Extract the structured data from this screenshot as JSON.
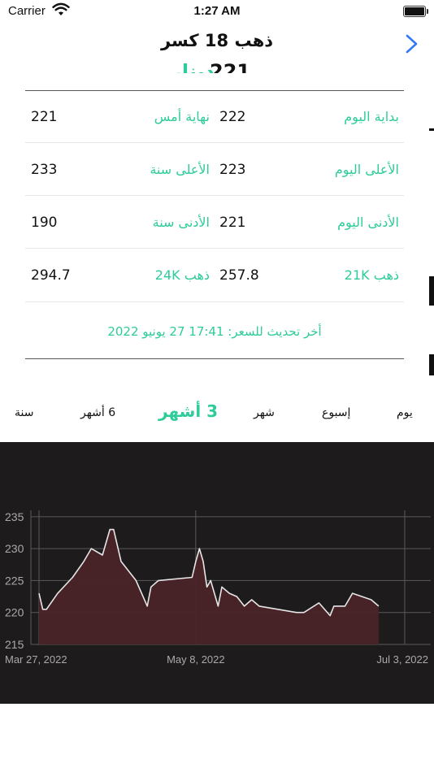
{
  "status_bar": {
    "carrier": "Carrier",
    "time": "1:27 AM"
  },
  "nav": {
    "title": "ذهب 18 كسر"
  },
  "price_header": {
    "value": "221",
    "unit": "دينار"
  },
  "stats": {
    "day_open_label": "بداية اليوم",
    "day_open": "222",
    "prev_close_label": "نهاية أمس",
    "prev_close": "221",
    "day_high_label": "الأعلى اليوم",
    "day_high": "223",
    "year_high_label": "الأعلى سنة",
    "year_high": "233",
    "day_low_label": "الأدنى اليوم",
    "day_low": "221",
    "year_low_label": "الأدنى سنة",
    "year_low": "190",
    "gold21_label": "ذهب 21K",
    "gold21": "257.8",
    "gold24_label": "ذهب 24K",
    "gold24": "294.7"
  },
  "last_update": "أخر تحديث للسعر: 17:41 27 يونيو 2022",
  "tabs": [
    {
      "label": "يوم",
      "active": false
    },
    {
      "label": "إسبوع",
      "active": false
    },
    {
      "label": "شهر",
      "active": false
    },
    {
      "label": "3 أشهر",
      "active": true
    },
    {
      "label": "6 أشهر",
      "active": false
    },
    {
      "label": "سنة",
      "active": false
    }
  ],
  "colors": {
    "accent": "#2ecc9a",
    "chart_bg": "#1d1b1c",
    "chart_line": "#e6e6e6",
    "chart_fill": "#4a2328"
  },
  "chart_data": {
    "type": "area",
    "y_ticks": [
      "235",
      "230",
      "225",
      "220",
      "215"
    ],
    "ylim": [
      215,
      236
    ],
    "x_labels": [
      "Mar 27, 2022",
      "May 8, 2022",
      "Jul 3, 2022"
    ],
    "grid": true,
    "series": [
      {
        "x": [
          "2022-03-27",
          "2022-03-28",
          "2022-03-29",
          "2022-04-01",
          "2022-04-05",
          "2022-04-08",
          "2022-04-10",
          "2022-04-13",
          "2022-04-15",
          "2022-04-16",
          "2022-04-18",
          "2022-04-22",
          "2022-04-25",
          "2022-04-26",
          "2022-04-28",
          "2022-05-07",
          "2022-05-08",
          "2022-05-09",
          "2022-05-10",
          "2022-05-11",
          "2022-05-12",
          "2022-05-14",
          "2022-05-15",
          "2022-05-17",
          "2022-05-19",
          "2022-05-21",
          "2022-05-23",
          "2022-05-25",
          "2022-06-04",
          "2022-06-06",
          "2022-06-10",
          "2022-06-13",
          "2022-06-14",
          "2022-06-17",
          "2022-06-19",
          "2022-06-24",
          "2022-06-26"
        ],
        "y": [
          223,
          220.5,
          220.5,
          223,
          225.5,
          228,
          230,
          229,
          233,
          233,
          228,
          225,
          221,
          224,
          225,
          225.5,
          228,
          230,
          228,
          224,
          225,
          221,
          224,
          223,
          222.5,
          221,
          222,
          221,
          220,
          220,
          221.5,
          219.5,
          221,
          221,
          223,
          222,
          221
        ]
      }
    ]
  }
}
